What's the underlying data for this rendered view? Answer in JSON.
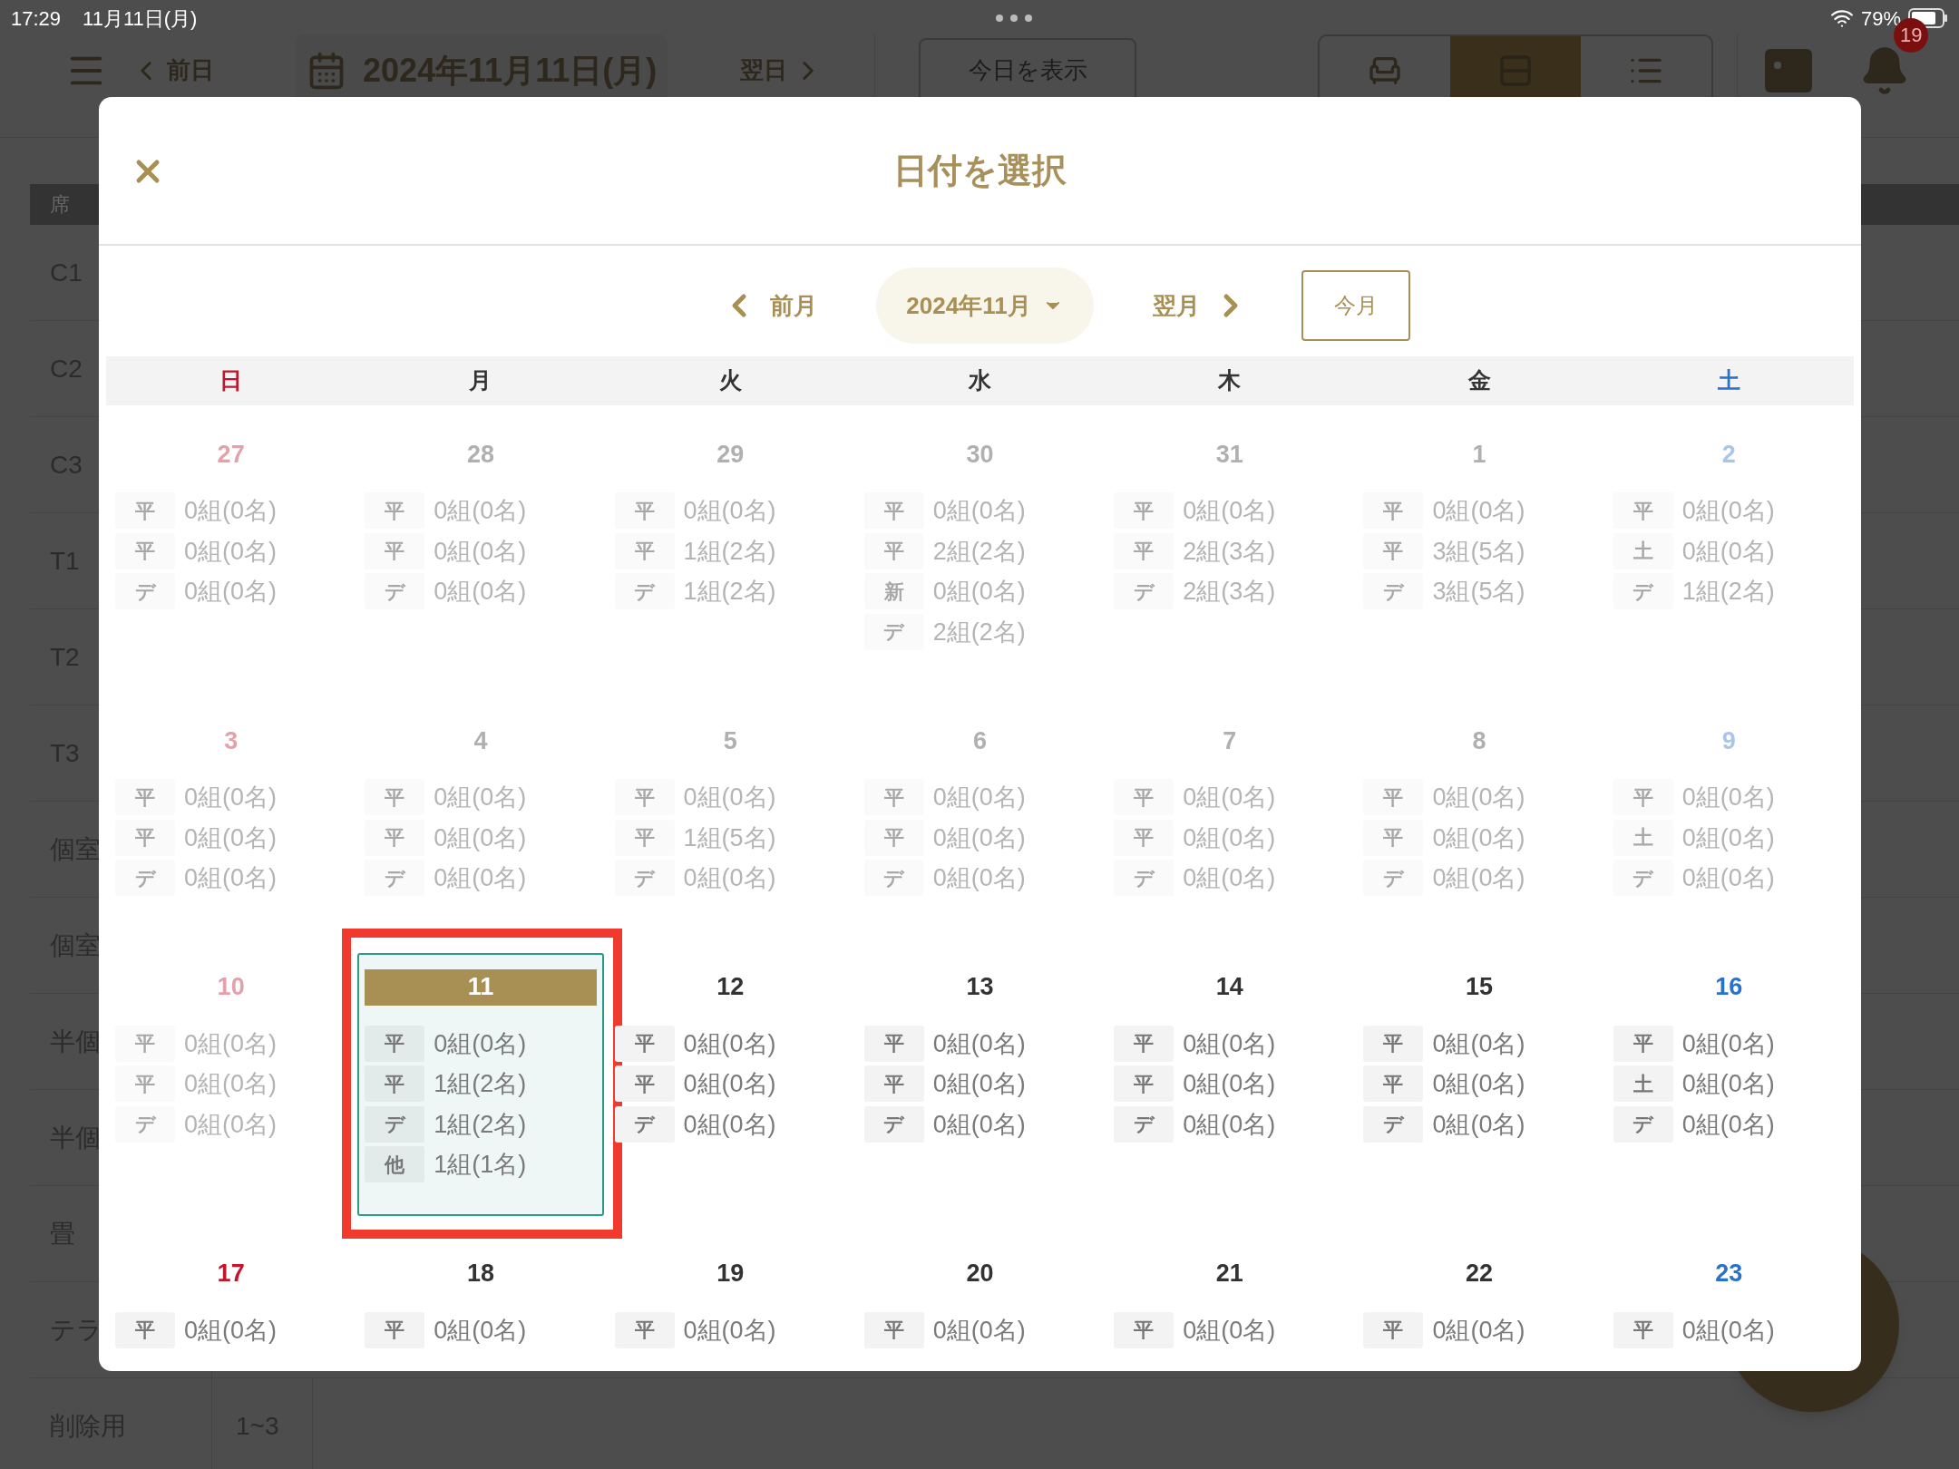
{
  "status_bar": {
    "time": "17:29",
    "date": "11月11日(月)",
    "battery": "79%"
  },
  "toolbar": {
    "prev_day": "前日",
    "date": "2024年11月11日(月)",
    "next_day": "翌日",
    "today_button": "今日を表示",
    "view_modes": [
      {
        "kind": "seat",
        "selected": false
      },
      {
        "kind": "rows",
        "selected": true
      },
      {
        "kind": "list",
        "selected": false
      }
    ],
    "notification_count": "19"
  },
  "table": {
    "header": "席",
    "rows": [
      {
        "name": "C1"
      },
      {
        "name": "C2"
      },
      {
        "name": "C3"
      },
      {
        "name": "T1"
      },
      {
        "name": "T2"
      },
      {
        "name": "T3"
      },
      {
        "name": "個室"
      },
      {
        "name": "個室"
      },
      {
        "name": "半個"
      },
      {
        "name": "半個"
      },
      {
        "name": "畳"
      },
      {
        "name": "テラ"
      },
      {
        "name": "削除用",
        "capacity": "1~3"
      }
    ]
  },
  "dialog": {
    "title": "日付を選択",
    "prev_month": "前月",
    "month": "2024年11月",
    "next_month": "翌月",
    "current_month_button": "今月",
    "weekdays": [
      {
        "label": "日",
        "kind": "sunday"
      },
      {
        "label": "月",
        "kind": "weekday"
      },
      {
        "label": "火",
        "kind": "weekday"
      },
      {
        "label": "水",
        "kind": "weekday"
      },
      {
        "label": "木",
        "kind": "weekday"
      },
      {
        "label": "金",
        "kind": "weekday"
      },
      {
        "label": "土",
        "kind": "saturday"
      }
    ],
    "weeks": [
      [
        {
          "date": "27",
          "muted": true,
          "selected": false,
          "entries": [
            {
              "label": "平",
              "value": "0組(0名)"
            },
            {
              "label": "平",
              "value": "0組(0名)"
            },
            {
              "label": "デ",
              "value": "0組(0名)"
            }
          ]
        },
        {
          "date": "28",
          "muted": true,
          "selected": false,
          "entries": [
            {
              "label": "平",
              "value": "0組(0名)"
            },
            {
              "label": "平",
              "value": "0組(0名)"
            },
            {
              "label": "デ",
              "value": "0組(0名)"
            }
          ]
        },
        {
          "date": "29",
          "muted": true,
          "selected": false,
          "entries": [
            {
              "label": "平",
              "value": "0組(0名)"
            },
            {
              "label": "平",
              "value": "1組(2名)"
            },
            {
              "label": "デ",
              "value": "1組(2名)"
            }
          ]
        },
        {
          "date": "30",
          "muted": true,
          "selected": false,
          "entries": [
            {
              "label": "平",
              "value": "0組(0名)"
            },
            {
              "label": "平",
              "value": "2組(2名)"
            },
            {
              "label": "新",
              "value": "0組(0名)"
            },
            {
              "label": "デ",
              "value": "2組(2名)"
            }
          ]
        },
        {
          "date": "31",
          "muted": true,
          "selected": false,
          "entries": [
            {
              "label": "平",
              "value": "0組(0名)"
            },
            {
              "label": "平",
              "value": "2組(3名)"
            },
            {
              "label": "デ",
              "value": "2組(3名)"
            }
          ]
        },
        {
          "date": "1",
          "muted": true,
          "selected": false,
          "entries": [
            {
              "label": "平",
              "value": "0組(0名)"
            },
            {
              "label": "平",
              "value": "3組(5名)"
            },
            {
              "label": "デ",
              "value": "3組(5名)"
            }
          ]
        },
        {
          "date": "2",
          "muted": true,
          "selected": false,
          "entries": [
            {
              "label": "平",
              "value": "0組(0名)"
            },
            {
              "label": "土",
              "value": "0組(0名)"
            },
            {
              "label": "デ",
              "value": "1組(2名)"
            }
          ]
        }
      ],
      [
        {
          "date": "3",
          "muted": true,
          "selected": false,
          "entries": [
            {
              "label": "平",
              "value": "0組(0名)"
            },
            {
              "label": "平",
              "value": "0組(0名)"
            },
            {
              "label": "デ",
              "value": "0組(0名)"
            }
          ]
        },
        {
          "date": "4",
          "muted": true,
          "selected": false,
          "entries": [
            {
              "label": "平",
              "value": "0組(0名)"
            },
            {
              "label": "平",
              "value": "0組(0名)"
            },
            {
              "label": "デ",
              "value": "0組(0名)"
            }
          ]
        },
        {
          "date": "5",
          "muted": true,
          "selected": false,
          "entries": [
            {
              "label": "平",
              "value": "0組(0名)"
            },
            {
              "label": "平",
              "value": "1組(5名)"
            },
            {
              "label": "デ",
              "value": "0組(0名)"
            }
          ]
        },
        {
          "date": "6",
          "muted": true,
          "selected": false,
          "entries": [
            {
              "label": "平",
              "value": "0組(0名)"
            },
            {
              "label": "平",
              "value": "0組(0名)"
            },
            {
              "label": "デ",
              "value": "0組(0名)"
            }
          ]
        },
        {
          "date": "7",
          "muted": true,
          "selected": false,
          "entries": [
            {
              "label": "平",
              "value": "0組(0名)"
            },
            {
              "label": "平",
              "value": "0組(0名)"
            },
            {
              "label": "デ",
              "value": "0組(0名)"
            }
          ]
        },
        {
          "date": "8",
          "muted": true,
          "selected": false,
          "entries": [
            {
              "label": "平",
              "value": "0組(0名)"
            },
            {
              "label": "平",
              "value": "0組(0名)"
            },
            {
              "label": "デ",
              "value": "0組(0名)"
            }
          ]
        },
        {
          "date": "9",
          "muted": true,
          "selected": false,
          "entries": [
            {
              "label": "平",
              "value": "0組(0名)"
            },
            {
              "label": "土",
              "value": "0組(0名)"
            },
            {
              "label": "デ",
              "value": "0組(0名)"
            }
          ]
        }
      ],
      [
        {
          "date": "10",
          "muted": true,
          "selected": false,
          "entries": [
            {
              "label": "平",
              "value": "0組(0名)"
            },
            {
              "label": "平",
              "value": "0組(0名)"
            },
            {
              "label": "デ",
              "value": "0組(0名)"
            }
          ]
        },
        {
          "date": "11",
          "muted": false,
          "selected": true,
          "entries": [
            {
              "label": "平",
              "value": "0組(0名)"
            },
            {
              "label": "平",
              "value": "1組(2名)"
            },
            {
              "label": "デ",
              "value": "1組(2名)"
            },
            {
              "label": "他",
              "value": "1組(1名)"
            }
          ]
        },
        {
          "date": "12",
          "muted": false,
          "selected": false,
          "entries": [
            {
              "label": "平",
              "value": "0組(0名)"
            },
            {
              "label": "平",
              "value": "0組(0名)"
            },
            {
              "label": "デ",
              "value": "0組(0名)"
            }
          ]
        },
        {
          "date": "13",
          "muted": false,
          "selected": false,
          "entries": [
            {
              "label": "平",
              "value": "0組(0名)"
            },
            {
              "label": "平",
              "value": "0組(0名)"
            },
            {
              "label": "デ",
              "value": "0組(0名)"
            }
          ]
        },
        {
          "date": "14",
          "muted": false,
          "selected": false,
          "entries": [
            {
              "label": "平",
              "value": "0組(0名)"
            },
            {
              "label": "平",
              "value": "0組(0名)"
            },
            {
              "label": "デ",
              "value": "0組(0名)"
            }
          ]
        },
        {
          "date": "15",
          "muted": false,
          "selected": false,
          "entries": [
            {
              "label": "平",
              "value": "0組(0名)"
            },
            {
              "label": "平",
              "value": "0組(0名)"
            },
            {
              "label": "デ",
              "value": "0組(0名)"
            }
          ]
        },
        {
          "date": "16",
          "muted": false,
          "selected": false,
          "entries": [
            {
              "label": "平",
              "value": "0組(0名)"
            },
            {
              "label": "土",
              "value": "0組(0名)"
            },
            {
              "label": "デ",
              "value": "0組(0名)"
            }
          ]
        }
      ],
      [
        {
          "date": "17",
          "muted": false,
          "selected": false,
          "entries": [
            {
              "label": "平",
              "value": "0組(0名)"
            }
          ]
        },
        {
          "date": "18",
          "muted": false,
          "selected": false,
          "entries": [
            {
              "label": "平",
              "value": "0組(0名)"
            }
          ]
        },
        {
          "date": "19",
          "muted": false,
          "selected": false,
          "entries": [
            {
              "label": "平",
              "value": "0組(0名)"
            }
          ]
        },
        {
          "date": "20",
          "muted": false,
          "selected": false,
          "entries": [
            {
              "label": "平",
              "value": "0組(0名)"
            }
          ]
        },
        {
          "date": "21",
          "muted": false,
          "selected": false,
          "entries": [
            {
              "label": "平",
              "value": "0組(0名)"
            }
          ]
        },
        {
          "date": "22",
          "muted": false,
          "selected": false,
          "entries": [
            {
              "label": "平",
              "value": "0組(0名)"
            }
          ]
        },
        {
          "date": "23",
          "muted": false,
          "selected": false,
          "entries": [
            {
              "label": "平",
              "value": "0組(0名)"
            }
          ]
        }
      ]
    ]
  }
}
